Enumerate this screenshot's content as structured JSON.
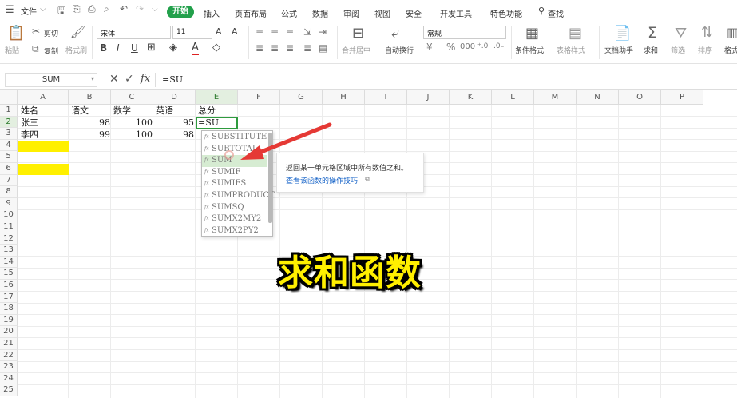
{
  "topbar": {
    "file_menu": "文件",
    "tabs": [
      "开始",
      "插入",
      "页面布局",
      "公式",
      "数据",
      "审阅",
      "视图",
      "安全",
      "开发工具",
      "特色功能"
    ],
    "active_tab": "开始",
    "search": "查找",
    "accent_color": "#22a04b"
  },
  "ribbon": {
    "paste": "粘贴",
    "cut": "剪切",
    "copy": "复制",
    "format_painter": "格式刷",
    "font_name": "宋体",
    "font_size": "11",
    "merge_center": "合并居中",
    "wrap_text": "自动换行",
    "number_format": "常规",
    "conditional_format": "条件格式",
    "table_style": "表格样式",
    "doc_assistant": "文档助手",
    "sum": "求和",
    "filter": "筛选",
    "sort": "排序",
    "format": "格式"
  },
  "formula_bar": {
    "name_box": "SUM",
    "fx": "fx",
    "formula": "=SU"
  },
  "columns": [
    "A",
    "B",
    "C",
    "D",
    "E",
    "F",
    "G",
    "H",
    "I",
    "J",
    "K",
    "L",
    "M",
    "N",
    "O",
    "P"
  ],
  "selected_column": "E",
  "rows": [
    "1",
    "2",
    "3",
    "4",
    "5",
    "6",
    "7",
    "8",
    "9",
    "10",
    "11",
    "12",
    "13",
    "14",
    "15",
    "16",
    "17",
    "18",
    "19",
    "20",
    "21",
    "22",
    "23",
    "24",
    "25"
  ],
  "selected_row": "2",
  "cells": {
    "a1": "姓名",
    "b1": "语文",
    "c1": "数学",
    "d1": "英语",
    "e1": "总分",
    "a2": "张三",
    "b2": "98",
    "c2": "100",
    "d2": "95",
    "e2": "=SU",
    "a3": "李四",
    "b3": "99",
    "c3": "100",
    "d3": "98"
  },
  "autocomplete": {
    "items": [
      "SUBSTITUTE",
      "SUBTOTAL",
      "SUM",
      "SUMIF",
      "SUMIFS",
      "SUMPRODUCT",
      "SUMSQ",
      "SUMX2MY2",
      "SUMX2PY2"
    ],
    "highlighted": "SUM"
  },
  "tooltip": {
    "description": "返回某一单元格区域中所有数值之和。",
    "link": "查看该函数的操作技巧"
  },
  "caption": "求和函数",
  "colors": {
    "highlight_fill": "#fff000",
    "arrow": "#e53935",
    "caption_text": "#ffef00"
  }
}
